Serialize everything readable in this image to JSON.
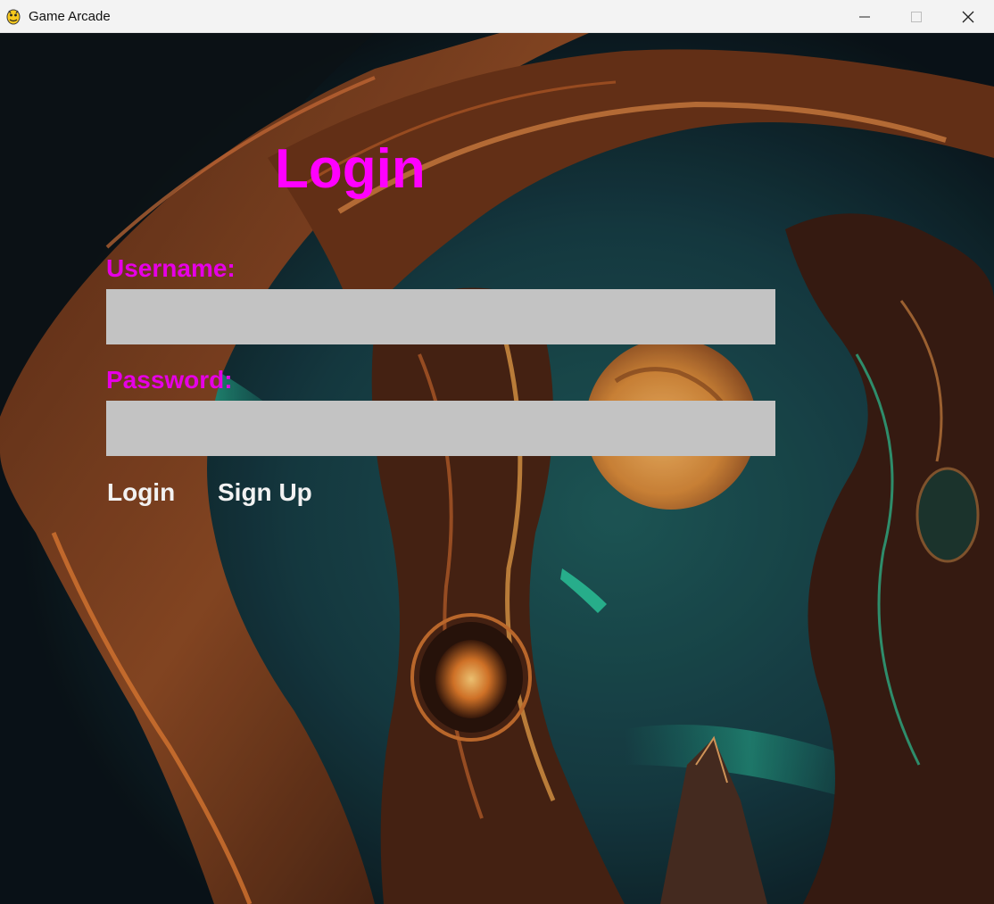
{
  "window": {
    "title": "Game Arcade",
    "app_icon": "pygame-snake-icon",
    "controls": [
      "minimize-icon",
      "maximize-icon",
      "close-icon"
    ]
  },
  "login": {
    "heading": "Login",
    "username_label": "Username:",
    "username_value": "",
    "password_label": "Password:",
    "password_value": "",
    "login_button": "Login",
    "signup_button": "Sign Up"
  },
  "colors": {
    "heading": "#ff00ff",
    "labels": "#e600e6",
    "input_background": "#c3c3c3",
    "button_text": "#f2f2f2"
  }
}
